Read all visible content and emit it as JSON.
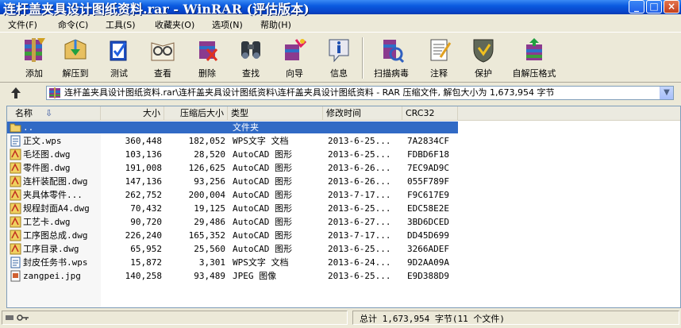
{
  "window": {
    "title": "连杆盖夹具设计图纸资料.rar - WinRAR (评估版本)",
    "minimize": "_",
    "maximize": "□",
    "close": "×"
  },
  "menu": [
    "文件(F)",
    "命令(C)",
    "工具(S)",
    "收藏夹(O)",
    "选项(N)",
    "帮助(H)"
  ],
  "toolbar": [
    {
      "label": "添加",
      "icon": "add-archive-icon"
    },
    {
      "label": "解压到",
      "icon": "extract-to-icon"
    },
    {
      "label": "测试",
      "icon": "test-icon"
    },
    {
      "label": "查看",
      "icon": "view-icon"
    },
    {
      "label": "删除",
      "icon": "delete-icon"
    },
    {
      "label": "查找",
      "icon": "find-icon"
    },
    {
      "label": "向导",
      "icon": "wizard-icon"
    },
    {
      "label": "信息",
      "icon": "info-icon"
    },
    {
      "label": "扫描病毒",
      "icon": "scan-virus-icon"
    },
    {
      "label": "注释",
      "icon": "comment-icon"
    },
    {
      "label": "保护",
      "icon": "protect-icon"
    },
    {
      "label": "自解压格式",
      "icon": "sfx-icon"
    }
  ],
  "address": {
    "path": "连杆盖夹具设计图纸资料.rar\\连杆盖夹具设计图纸资料\\连杆盖夹具设计图纸资料 - RAR 压缩文件, 解包大小为 1,673,954 字节"
  },
  "columns": {
    "name": "名称",
    "sort_arrow": "⇩",
    "size": "大小",
    "packed": "压缩后大小",
    "type": "类型",
    "modified": "修改时间",
    "crc": "CRC32"
  },
  "files": [
    {
      "name": "..",
      "size": "",
      "packed": "",
      "type": "文件夹",
      "modified": "",
      "crc": "",
      "icon": "folder-up-icon",
      "selected": true
    },
    {
      "name": "正文.wps",
      "size": "360,448",
      "packed": "182,052",
      "type": "WPS文字 文档",
      "modified": "2013-6-25...",
      "crc": "7A2834CF",
      "icon": "wps-doc-icon"
    },
    {
      "name": "毛坯图.dwg",
      "size": "103,136",
      "packed": "28,520",
      "type": "AutoCAD 图形",
      "modified": "2013-6-25...",
      "crc": "FDBD6F18",
      "icon": "dwg-file-icon"
    },
    {
      "name": "零件图.dwg",
      "size": "191,008",
      "packed": "126,625",
      "type": "AutoCAD 图形",
      "modified": "2013-6-26...",
      "crc": "7EC9AD9C",
      "icon": "dwg-file-icon"
    },
    {
      "name": "连杆装配图.dwg",
      "size": "147,136",
      "packed": "93,256",
      "type": "AutoCAD 图形",
      "modified": "2013-6-26...",
      "crc": "055F789F",
      "icon": "dwg-file-icon"
    },
    {
      "name": "夹具体零件...",
      "size": "262,752",
      "packed": "200,004",
      "type": "AutoCAD 图形",
      "modified": "2013-7-17...",
      "crc": "F9C617E9",
      "icon": "dwg-file-icon"
    },
    {
      "name": "规程封面A4.dwg",
      "size": "70,432",
      "packed": "19,125",
      "type": "AutoCAD 图形",
      "modified": "2013-6-25...",
      "crc": "EDC58E2E",
      "icon": "dwg-file-icon"
    },
    {
      "name": "工艺卡.dwg",
      "size": "90,720",
      "packed": "29,486",
      "type": "AutoCAD 图形",
      "modified": "2013-6-27...",
      "crc": "3BD6DCED",
      "icon": "dwg-file-icon"
    },
    {
      "name": "工序图总成.dwg",
      "size": "226,240",
      "packed": "165,352",
      "type": "AutoCAD 图形",
      "modified": "2013-7-17...",
      "crc": "DD45D699",
      "icon": "dwg-file-icon"
    },
    {
      "name": "工序目录.dwg",
      "size": "65,952",
      "packed": "25,560",
      "type": "AutoCAD 图形",
      "modified": "2013-6-25...",
      "crc": "3266ADEF",
      "icon": "dwg-file-icon"
    },
    {
      "name": "封皮任务书.wps",
      "size": "15,872",
      "packed": "3,301",
      "type": "WPS文字 文档",
      "modified": "2013-6-24...",
      "crc": "9D2AA09A",
      "icon": "wps-doc-icon"
    },
    {
      "name": "zangpei.jpg",
      "size": "140,258",
      "packed": "93,489",
      "type": "JPEG 图像",
      "modified": "2013-6-25...",
      "crc": "E9D388D9",
      "icon": "jpeg-image-icon"
    }
  ],
  "status": {
    "left": "",
    "right": "总计 1,673,954 字节(11 个文件)"
  }
}
